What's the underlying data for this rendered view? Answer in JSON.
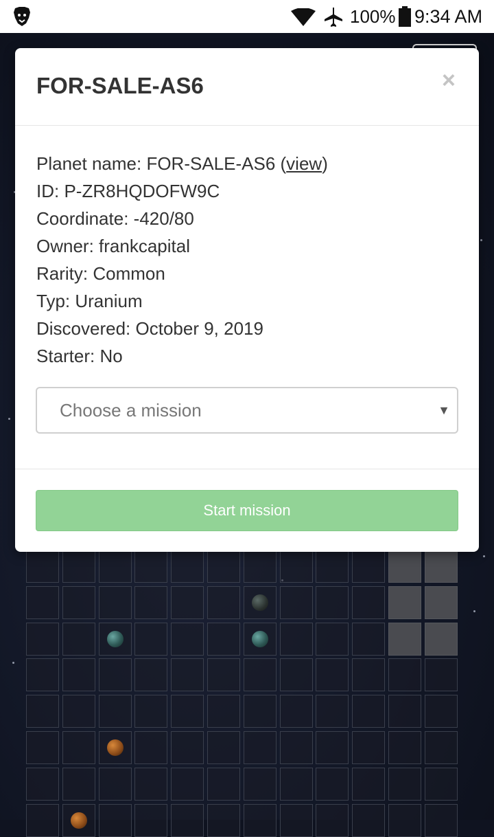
{
  "status_bar": {
    "battery_percent": "100%",
    "time": "9:34 AM",
    "icons": [
      "brave-lion-icon",
      "wifi-icon",
      "airplane-icon",
      "battery-icon"
    ]
  },
  "modal": {
    "title": "FOR-SALE-AS6",
    "close_label": "×",
    "fields": [
      {
        "label": "Planet name:",
        "value": "FOR-SALE-AS6",
        "link": "view"
      },
      {
        "label": "ID:",
        "value": "P-ZR8HQDOFW9C"
      },
      {
        "label": "Coordinate:",
        "value": "-420/80"
      },
      {
        "label": "Owner:",
        "value": "frankcapital"
      },
      {
        "label": "Rarity:",
        "value": "Common"
      },
      {
        "label": "Typ:",
        "value": "Uranium"
      },
      {
        "label": "Discovered:",
        "value": "October 9, 2019"
      },
      {
        "label": "Starter:",
        "value": "No"
      }
    ],
    "mission_select": {
      "placeholder": "Choose a mission"
    },
    "start_button": "Start mission"
  },
  "colors": {
    "start_button": "#92d396",
    "background": "#121726"
  }
}
